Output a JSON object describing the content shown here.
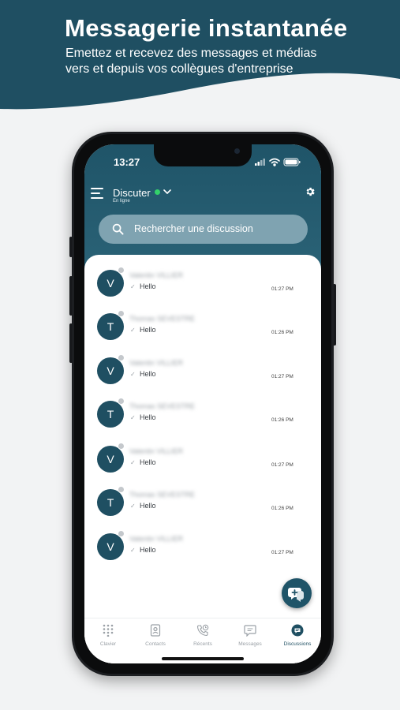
{
  "banner": {
    "headline": "Messagerie instantanée",
    "subline_1": "Emettez et recevez des messages et médias",
    "subline_2": "vers et depuis vos collègues d'entreprise",
    "color": "#1f4f62"
  },
  "status_bar": {
    "time": "13:27"
  },
  "header": {
    "title": "Discuter",
    "presence": "En ligne",
    "online_color": "#33d16a"
  },
  "search": {
    "placeholder": "Rechercher une discussion"
  },
  "conversations": [
    {
      "initial": "V",
      "name": "Valentin VILLIER",
      "message": "Hello",
      "time": "01:27 PM"
    },
    {
      "initial": "T",
      "name": "Thomas SEVESTRE",
      "message": "Hello",
      "time": "01:26 PM"
    },
    {
      "initial": "V",
      "name": "Valentin VILLIER",
      "message": "Hello",
      "time": "01:27 PM"
    },
    {
      "initial": "T",
      "name": "Thomas SEVESTRE",
      "message": "Hello",
      "time": "01:26 PM"
    },
    {
      "initial": "V",
      "name": "Valentin VILLIER",
      "message": "Hello",
      "time": "01:27 PM"
    },
    {
      "initial": "T",
      "name": "Thomas SEVESTRE",
      "message": "Hello",
      "time": "01:26 PM"
    },
    {
      "initial": "V",
      "name": "Valentin VILLIER",
      "message": "Hello",
      "time": "01:27 PM"
    }
  ],
  "tabs": [
    {
      "label": "Clavier",
      "icon": "dialpad-icon"
    },
    {
      "label": "Contacts",
      "icon": "contacts-icon"
    },
    {
      "label": "Récents",
      "icon": "recent-calls-icon"
    },
    {
      "label": "Messages",
      "icon": "messages-icon"
    },
    {
      "label": "Discussions",
      "icon": "discussions-icon",
      "active": true
    }
  ],
  "accent_color": "#1f4f62"
}
